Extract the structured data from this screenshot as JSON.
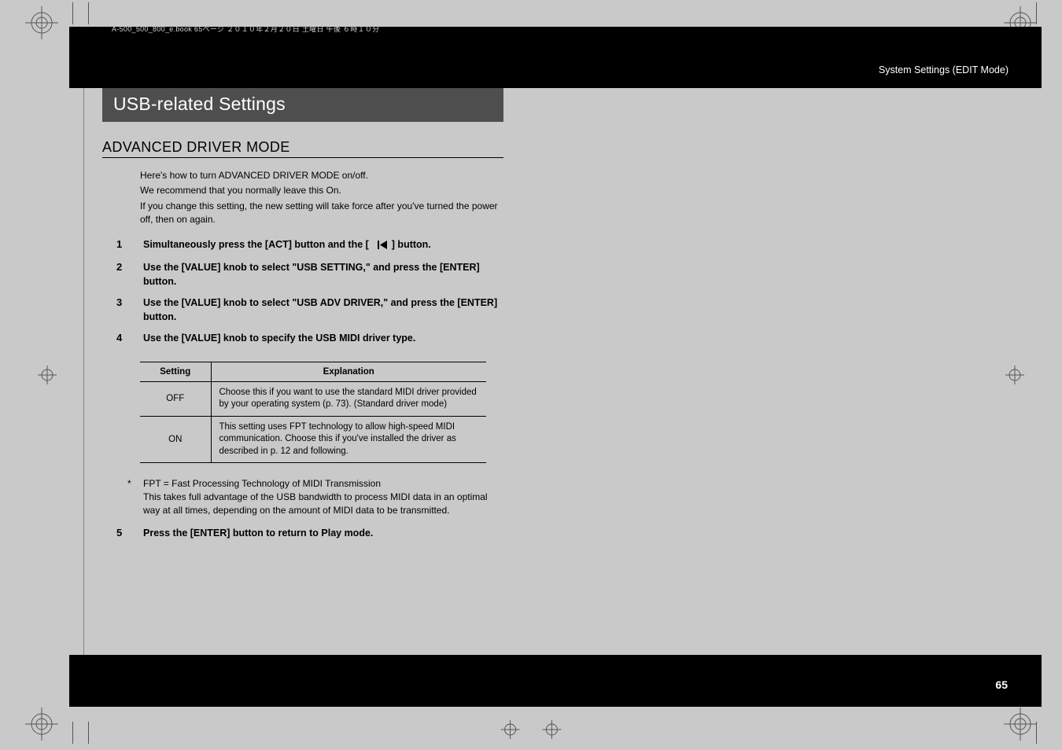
{
  "breadcrumb": "System Settings (EDIT Mode)",
  "page_number": "65",
  "section_title": "USB-related Settings",
  "subheading": "ADVANCED DRIVER MODE",
  "intro": {
    "p1": "Here's how to turn ADVANCED DRIVER MODE on/off.",
    "p2": "We recommend that you normally leave this On.",
    "p3": "If you change this setting, the new setting will take force after you've turned the power off, then on again."
  },
  "steps": [
    {
      "num": "1",
      "text_before": "Simultaneously press the [ACT] button and the [",
      "text_after": "] button."
    },
    {
      "num": "2",
      "text": "Use the [VALUE] knob to select \"USB SETTING,\" and press the [ENTER] button."
    },
    {
      "num": "3",
      "text": "Use the [VALUE] knob to select \"USB ADV DRIVER,\" and press the [ENTER] button."
    },
    {
      "num": "4",
      "text": "Use the [VALUE] knob to specify the USB MIDI driver type."
    }
  ],
  "table": {
    "headers": {
      "setting": "Setting",
      "explanation": "Explanation"
    },
    "rows": [
      {
        "setting": "OFF",
        "explanation": "Choose this if you want to use the standard MIDI driver provided by your operating system (p. 73). (Standard driver mode)"
      },
      {
        "setting": "ON",
        "explanation": "This setting uses FPT technology to allow high-speed MIDI communication. Choose this if you've installed the driver as described in p. 12 and following."
      }
    ]
  },
  "footnote": {
    "ast": "*",
    "line1": "FPT = Fast Processing Technology of MIDI Transmission",
    "line2": "This takes full advantage of the USB bandwidth to process MIDI data in an optimal way at all times, depending on the amount of MIDI data to be transmitted."
  },
  "step5": {
    "num": "5",
    "text": "Press the [ENTER] button to return to Play mode."
  },
  "tiny_meta": "A-500_500_800_e.book  65ページ  ２０１０年２月２０日  土曜日  午後  ６時１０分"
}
